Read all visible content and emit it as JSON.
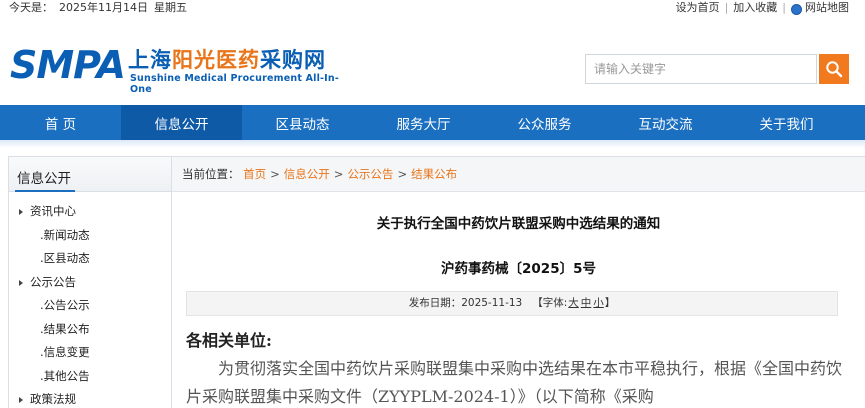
{
  "topbar": {
    "today_label": "今天是：",
    "date": "2025年11月14日",
    "weekday": "星期五",
    "set_home": "设为首页",
    "add_favorite": "加入收藏",
    "site_map": "网站地图"
  },
  "logo": {
    "abbr": "SMPA",
    "cn_part1": "上海",
    "cn_part2": "阳光医药",
    "cn_part3": "采购网",
    "en": "Sunshine Medical Procurement All-In-One"
  },
  "search": {
    "placeholder": "请输入关键字",
    "icon": "search-icon",
    "button_color": "#f27a1e"
  },
  "nav": {
    "items": [
      "首 页",
      "信息公开",
      "区县动态",
      "服务大厅",
      "公众服务",
      "互动交流",
      "关于我们"
    ],
    "active_index": 1,
    "color": "#1a6fc1",
    "active_color": "#0e5aa7"
  },
  "sidebar": {
    "title": "信息公开",
    "items": [
      {
        "label": "资讯中心",
        "type": "category"
      },
      {
        "label": ".新闻动态",
        "type": "sub"
      },
      {
        "label": ".区县动态",
        "type": "sub"
      },
      {
        "label": "公示公告",
        "type": "category"
      },
      {
        "label": ".公告公示",
        "type": "sub"
      },
      {
        "label": ".结果公布",
        "type": "sub"
      },
      {
        "label": ".信息变更",
        "type": "sub"
      },
      {
        "label": ".其他公告",
        "type": "sub"
      },
      {
        "label": "政策法规",
        "type": "category"
      }
    ]
  },
  "breadcrumb": {
    "label": "当前位置：",
    "items": [
      "首页",
      "信息公开",
      "公示公告",
      "结果公布"
    ],
    "link_color": "#e8751a"
  },
  "article": {
    "title": "关于执行全国中药饮片联盟采购中选结果的通知",
    "doc_number": "沪药事药械〔2025〕5号",
    "publish_label": "发布日期：",
    "publish_date": "2025-11-13",
    "font_size_label": "【字体:",
    "font_large": "大",
    "font_medium": "中",
    "font_small": "小",
    "font_size_end": "】",
    "greeting": "各相关单位:",
    "body": "为贯彻落实全国中药饮片采购联盟集中采购中选结果在本市平稳执行，根据《全国中药饮片采购联盟集中采购文件（ZYYPLM-2024-1）》（以下简称《采购"
  }
}
